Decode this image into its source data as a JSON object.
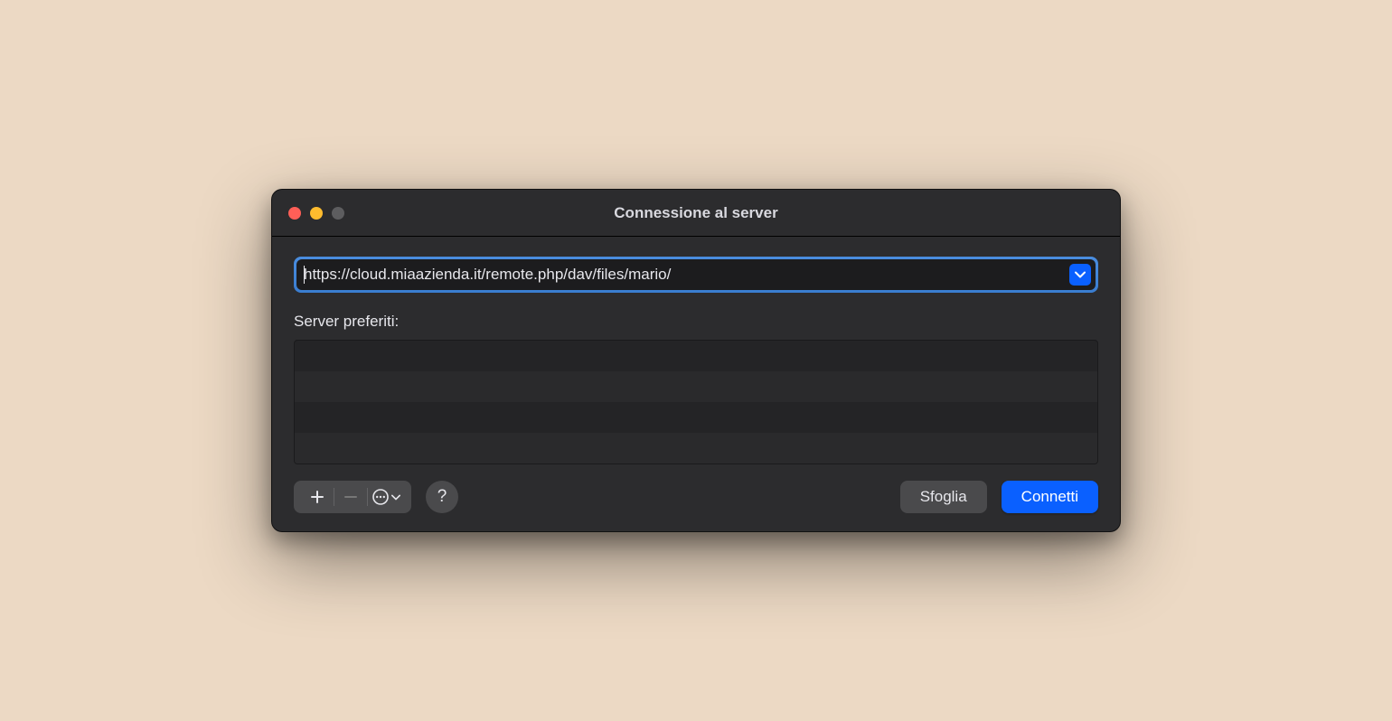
{
  "window": {
    "title": "Connessione al server"
  },
  "serverAddress": {
    "value": "https://cloud.miaazienda.it/remote.php/dav/files/mario/"
  },
  "favorites": {
    "label": "Server preferiti:",
    "items": [
      "",
      "",
      "",
      ""
    ]
  },
  "toolbar": {
    "helpLabel": "?"
  },
  "actions": {
    "browseLabel": "Sfoglia",
    "connectLabel": "Connetti"
  }
}
